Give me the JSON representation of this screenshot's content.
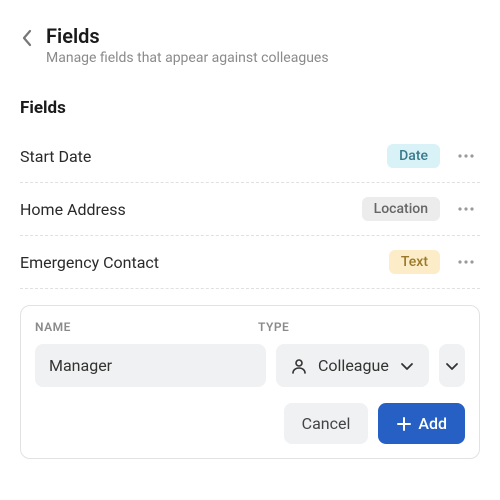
{
  "header": {
    "title": "Fields",
    "subtitle": "Manage fields that appear against colleagues"
  },
  "section_title": "Fields",
  "fields": [
    {
      "label": "Start Date",
      "badge": "Date",
      "badge_class": "badge-date"
    },
    {
      "label": "Home Address",
      "badge": "Location",
      "badge_class": "badge-location"
    },
    {
      "label": "Emergency Contact",
      "badge": "Text",
      "badge_class": "badge-text"
    }
  ],
  "add_form": {
    "columns": {
      "name": "NAME",
      "type": "TYPE"
    },
    "name_value": "Manager",
    "type_value": "Colleague",
    "cancel_label": "Cancel",
    "add_label": "Add"
  }
}
